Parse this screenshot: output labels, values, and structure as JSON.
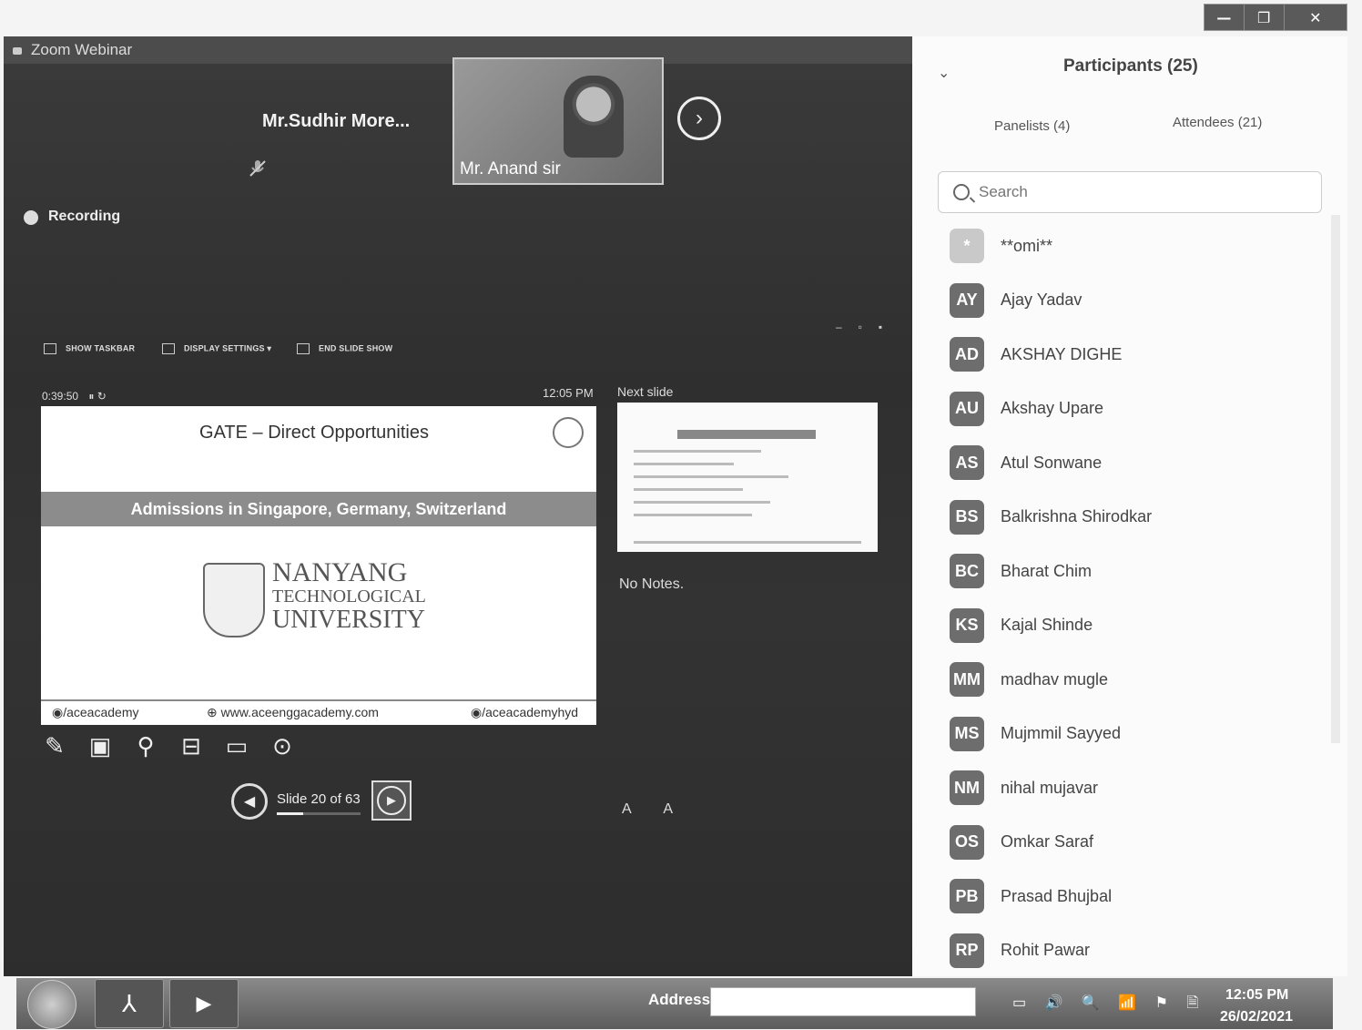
{
  "window": {
    "title": "Zoom Webinar",
    "controls": [
      "—",
      "❐",
      "✕"
    ]
  },
  "video": {
    "active_speaker": "Mr.Sudhir  More...",
    "thumbnail_label": "Mr. Anand sir"
  },
  "recording": {
    "label": "Recording"
  },
  "presenter_toolbar": {
    "show_taskbar": "SHOW TASKBAR",
    "display_settings": "DISPLAY SETTINGS ▾",
    "end_slide_show": "END SLIDE SHOW"
  },
  "presenter": {
    "timer": "0:39:50",
    "timer_controls": "⏸ ↻",
    "clock": "12:05 PM",
    "next_slide_label": "Next slide",
    "notes": "No Notes.",
    "slide_counter": "Slide 20 of 63",
    "slide_progress": 0.317,
    "font_buttons": "A A"
  },
  "slide": {
    "title": "GATE – Direct Opportunities",
    "band": "Admissions in Singapore, Germany, Switzerland",
    "logo_line1": "NANYANG",
    "logo_line2": "TECHNOLOGICAL",
    "logo_line3": "UNIVERSITY",
    "footer_left": "◉/aceacademy",
    "footer_mid": "⊕ www.aceenggacademy.com",
    "footer_right": "◉/aceacademyhyd"
  },
  "tools": [
    "pen-icon",
    "pointer-icon",
    "zoom-icon",
    "screen-icon",
    "subtitles-icon",
    "more-icon"
  ],
  "participants": {
    "title": "Participants (25)",
    "tab_panelists": "Panelists (4)",
    "tab_attendees": "Attendees (21)",
    "search_placeholder": "Search",
    "list": [
      {
        "initials": "*",
        "name": "**omi**"
      },
      {
        "initials": "AY",
        "name": "Ajay Yadav"
      },
      {
        "initials": "AD",
        "name": "AKSHAY DIGHE"
      },
      {
        "initials": "AU",
        "name": "Akshay Upare"
      },
      {
        "initials": "AS",
        "name": "Atul Sonwane"
      },
      {
        "initials": "BS",
        "name": "Balkrishna Shirodkar"
      },
      {
        "initials": "BC",
        "name": "Bharat Chim"
      },
      {
        "initials": "KS",
        "name": "Kajal Shinde"
      },
      {
        "initials": "MM",
        "name": "madhav mugle"
      },
      {
        "initials": "MS",
        "name": "Mujmmil Sayyed"
      },
      {
        "initials": "NM",
        "name": "nihal mujavar"
      },
      {
        "initials": "OS",
        "name": "Omkar Saraf"
      },
      {
        "initials": "PB",
        "name": "Prasad Bhujbal"
      },
      {
        "initials": "RP",
        "name": "Rohit Pawar"
      }
    ]
  },
  "taskbar": {
    "address_label": "Address",
    "address_value": "",
    "tray_icons": "▭ 🔊 🔍 📶 ⚑ 🗎",
    "time": "12:05 PM",
    "date": "26/02/2021"
  }
}
